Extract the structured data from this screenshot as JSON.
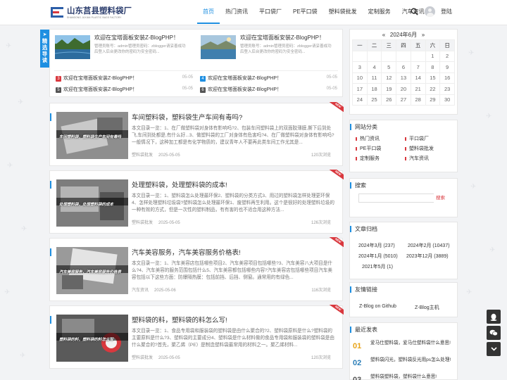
{
  "site": {
    "logo_cn": "山东莒县塑料袋厂",
    "logo_en": "SHANDONG JUXIAN PLASTIC BAGS FACTORY"
  },
  "nav": {
    "items": [
      "首页",
      "热门资讯",
      "平口袋厂",
      "PE平口袋",
      "塑料袋批发",
      "定制服务",
      "汽车资讯"
    ],
    "active": "首页",
    "login": "登陆",
    "accent": "#1e8fe1"
  },
  "side_tab": {
    "chars": [
      "精",
      "选",
      "导",
      "读"
    ]
  },
  "featured": {
    "cards": [
      {
        "title": "欢迎在宝塔面板安装Z-BlogPHP！",
        "desc": "管理员账号：admin管理员密码：zblogger请妥善成功后登入后台更改你的密码为安全密码..."
      },
      {
        "title": "欢迎在宝塔面板安装Z-BlogPHP！",
        "desc": "管理员账号：admin管理员密码：zblogger请妥善成功后登入后台更改你的密码为安全密码..."
      }
    ],
    "list": [
      {
        "num": "3",
        "color": "#d9383e",
        "title": "欢迎在宝塔面板安装Z-BlogPHP！",
        "date": "05-05"
      },
      {
        "num": "4",
        "color": "#1e8fe1",
        "title": "欢迎在宝塔面板安装Z-BlogPHP！",
        "date": "05-05"
      },
      {
        "num": "5",
        "color": "#555555",
        "title": "欢迎在宝塔面板安装Z-BlogPHP！",
        "date": "05-05"
      },
      {
        "num": "6",
        "color": "#555555",
        "title": "欢迎在宝塔面板安装Z-BlogPHP！",
        "date": "05-05"
      }
    ]
  },
  "posts": [
    {
      "title": "车间塑料袋，塑料袋生产车间有毒吗?",
      "thumb_text": "车间塑料袋，塑料袋生产车间有毒吗",
      "excerpt": "本文目录一览：1、在厂做塑料袋对身体有影响吗?2、包装车间塑料袋上的双面胶薄膜,撕下后到处飞,车间到处都是,有什么好...3、做塑料袋的工厂对身体有危害吗?4、在厂做塑料袋对身体有影响吗?一般情况下，这种加工都是有化学物质的，建议青年人不要再此类车间工作尤其是...",
      "category": "塑料袋批发",
      "date": "2025-05-05",
      "views": "120次浏览",
      "thumb_color": "#5a5a5a"
    },
    {
      "title": "处理塑料袋，处理塑料袋的成本!",
      "thumb_text": "处理塑料袋，处理塑料袋的成本",
      "excerpt": "本文目录一览：1、塑料袋怎么处理最环保2、塑料袋的分类方式3、用过的塑料袋怎样处理更环保4、怎样处理塑料垃圾袋?塑料袋怎么处理最环保1、废塑料再生利用。这个是很好的处理塑料垃圾的一种有效的方式，但是一次性的塑料制品，有有害的也不适合用这种方法...",
      "category": "塑料袋批发",
      "date": "2025-05-05",
      "views": "126次浏览",
      "thumb_color": "#4e4e4e"
    },
    {
      "title": "汽车美容服务，汽车美容服务价格表!",
      "thumb_text": "汽车美容服务，汽车美容服务价格表",
      "excerpt": "本文目录一览：1、汽车美容店包括哪些项目2、汽车美容项目包括哪些?3、汽车美容八大项目是什么?4、汽车美容的服务范围包括什么5、汽车美容都包括哪些内容?汽车美容店包括哪些项目汽车美容包括以下这些方面：防爆隔热膜：包括前挡、后挡、侧窗。通常用的有绿色...",
      "category": "汽车资讯",
      "date": "2025-05-06",
      "views": "116次浏览",
      "thumb_color": "#6a6a6a"
    },
    {
      "title": "塑料袋的料，塑料袋的料怎么写!",
      "thumb_text": "塑料袋的料，塑料袋的料怎么写",
      "excerpt": "本文目录一览：1、食品专用袋和服装袋的塑料袋是由什么聚合的?2、塑料袋原料是什么?塑料袋的主要原料是什么?3、塑料袋的主要成分4、塑料袋是什么材料做的食品专用袋和服装袋的塑料袋是由什么聚合的?首先，聚乙烯（PE）是制造塑料袋最常用的材料之一。聚乙烯材料...",
      "category": "塑料袋批发",
      "date": "2025-05-05",
      "views": "120次浏览",
      "thumb_color": "#3d3d3d"
    }
  ],
  "calendar": {
    "prev": "«",
    "month": "2024年6月",
    "next": "»",
    "weekdays": [
      "一",
      "二",
      "三",
      "四",
      "五",
      "六",
      "日"
    ],
    "weeks": [
      [
        "",
        "",
        "",
        "",
        "",
        "1",
        "2"
      ],
      [
        "3",
        "4",
        "5",
        "6",
        "7",
        "8",
        "9"
      ],
      [
        "10",
        "11",
        "12",
        "13",
        "14",
        "15",
        "16"
      ],
      [
        "17",
        "18",
        "19",
        "20",
        "21",
        "22",
        "23"
      ],
      [
        "24",
        "25",
        "26",
        "27",
        "28",
        "29",
        "30"
      ]
    ]
  },
  "categories": {
    "title": "网站分类",
    "items": [
      "热门资讯",
      "平口袋厂",
      "PE平口袋",
      "塑料袋批发",
      "定制服务",
      "汽车资讯"
    ]
  },
  "search": {
    "title": "搜索",
    "button": "搜索",
    "placeholder": ""
  },
  "archives": {
    "title": "文章归档",
    "items": [
      "2024年3月 (237)",
      "2024年2月 (10437)",
      "2024年1月 (5010)",
      "2023年12月 (3889)",
      "2021年5月 (1)"
    ]
  },
  "links": {
    "title": "友情链接",
    "items": [
      "Z-Blog on Github",
      "Z-Blog主机"
    ]
  },
  "recent": {
    "title": "最近发表",
    "items": [
      {
        "num": "01",
        "color": "#e8a317",
        "title": "爱马仕塑料袋，爱马仕塑料袋什么意思!"
      },
      {
        "num": "02",
        "color": "#2c7fb8",
        "title": "塑料袋闪光，塑料袋反光用ps怎么处理!"
      },
      {
        "num": "03",
        "color": "#555555",
        "title": "塑料袋塑料袋，塑料袋什么意思!"
      }
    ]
  }
}
